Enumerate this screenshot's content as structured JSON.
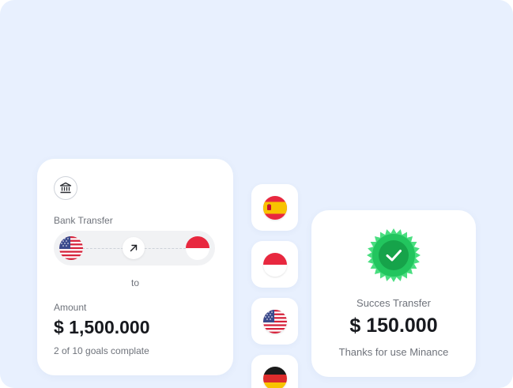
{
  "bank_card": {
    "icon": "bank-icon",
    "label": "Bank Transfer",
    "from_flag": "us-flag-icon",
    "arrow_icon": "arrow-up-right-icon",
    "to_flag": "indonesia-flag-icon",
    "to_label": "to",
    "amount_label": "Amount",
    "amount_value": "$ 1,500.000",
    "goals_text": "2 of 10 goals complate"
  },
  "flag_tiles": [
    {
      "icon": "spain-flag-icon"
    },
    {
      "icon": "indonesia-flag-icon"
    },
    {
      "icon": "us-flag-icon"
    },
    {
      "icon": "germany-flag-icon"
    }
  ],
  "success_card": {
    "icon": "check-badge-icon",
    "title": "Succes Transfer",
    "amount": "$ 150.000",
    "subtitle": "Thanks for use Minance"
  },
  "colors": {
    "background": "#e8f0fe",
    "card": "#ffffff",
    "success_green": "#22c55e",
    "text_primary": "#17191e",
    "text_secondary": "#6f737b"
  }
}
